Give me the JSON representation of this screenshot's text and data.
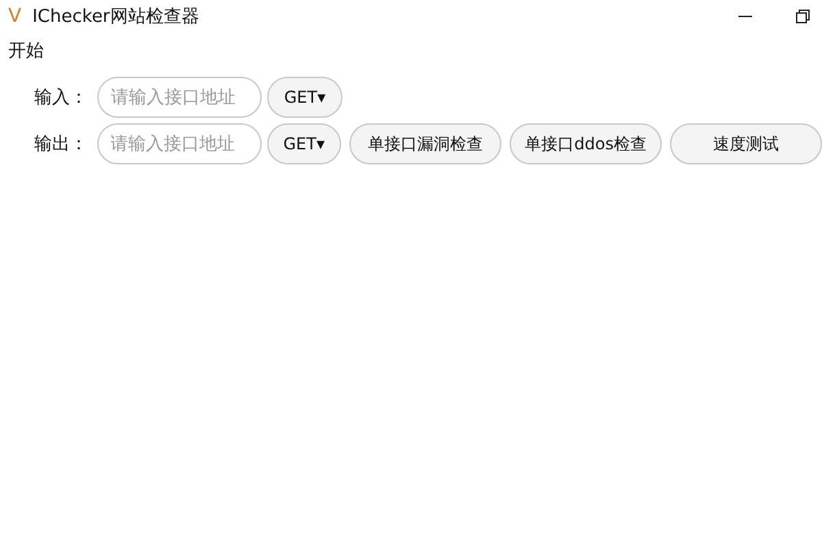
{
  "window": {
    "logo": "V",
    "title": "IChecker网站检查器"
  },
  "menu": [
    "开始"
  ],
  "rows": [
    {
      "label": "输入：",
      "input": {
        "placeholder": "请输入接口地址"
      },
      "method": "GET▾",
      "buttons": []
    },
    {
      "label": "输出：",
      "input": {
        "placeholder": "请输入接口地址"
      },
      "method": "GET▾",
      "buttons": [
        "单接口漏洞检查",
        "单接口ddos检查",
        "速度测试"
      ]
    }
  ]
}
